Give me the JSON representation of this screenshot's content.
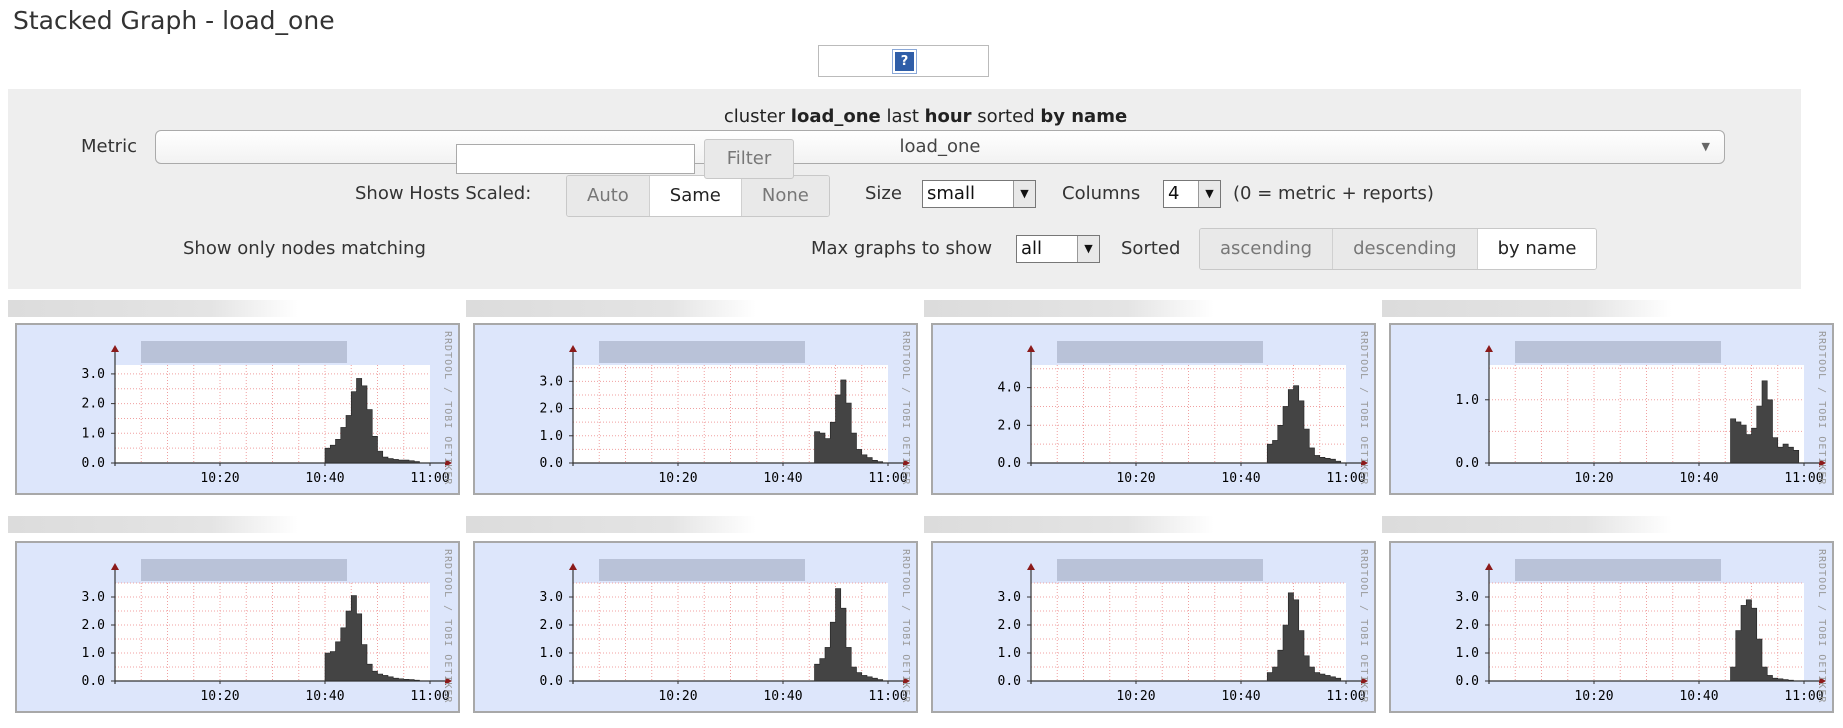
{
  "page": {
    "title": "Stacked Graph - load_one"
  },
  "help": {
    "icon": "help-icon",
    "glyph": "?"
  },
  "description": {
    "p1": "cluster ",
    "metric": "load_one",
    "p2": " last ",
    "range": "hour",
    "p3": " sorted ",
    "sort": "by name"
  },
  "controls": {
    "metric_label": "Metric",
    "metric_value": "load_one",
    "scaled_label": "Show Hosts Scaled:",
    "scaled_options": [
      "Auto",
      "Same",
      "None"
    ],
    "scaled_selected": "Same",
    "size_label": "Size",
    "size_value": "small",
    "columns_label": "Columns",
    "columns_value": "4",
    "columns_note": "(0 = metric + reports)",
    "filter_label": "Show only nodes matching",
    "filter_value": "",
    "filter_button": "Filter",
    "max_label": "Max graphs to show",
    "max_value": "all",
    "sorted_label": "Sorted",
    "sort_options": [
      "ascending",
      "descending",
      "by name"
    ],
    "sort_selected": "by name"
  },
  "graphs": {
    "x_ticks": [
      "10:20",
      "10:40",
      "11:00"
    ],
    "watermark": "RRDTOOL / TOBI OETIKER",
    "colors": {
      "background": "#dde6fb",
      "plot": "#ffffff",
      "grid": "#f0a0a0",
      "area": "#444444",
      "axis": "#333333",
      "arrow": "#8b1a1a"
    },
    "items": [
      {
        "yticks": [
          "0.0",
          "1.0",
          "2.0",
          "3.0"
        ],
        "ymax": 3.3,
        "series": [
          0,
          0,
          0,
          0,
          0,
          0,
          0,
          0,
          0,
          0,
          0,
          0,
          0,
          0,
          0,
          0,
          0,
          0,
          0,
          0,
          0,
          0,
          0,
          0,
          0,
          0,
          0,
          0,
          0,
          0,
          0,
          0,
          0,
          0,
          0,
          0,
          0,
          0,
          0,
          0,
          0.5,
          0.6,
          0.8,
          1.2,
          1.6,
          2.4,
          2.85,
          2.6,
          1.8,
          0.9,
          0.4,
          0.2,
          0.15,
          0.12,
          0.1,
          0.1,
          0.08,
          0.05,
          0,
          0
        ]
      },
      {
        "yticks": [
          "0.0",
          "1.0",
          "2.0",
          "3.0"
        ],
        "ymax": 3.6,
        "series": [
          0,
          0,
          0,
          0,
          0,
          0,
          0,
          0,
          0,
          0,
          0,
          0,
          0,
          0,
          0,
          0,
          0,
          0,
          0,
          0,
          0,
          0,
          0,
          0,
          0,
          0,
          0,
          0,
          0,
          0,
          0,
          0,
          0,
          0,
          0,
          0,
          0,
          0,
          0,
          0,
          0,
          0,
          0,
          0,
          0,
          0,
          1.15,
          1.1,
          0.9,
          1.5,
          2.5,
          3.05,
          2.2,
          1.1,
          0.5,
          0.3,
          0.2,
          0.1,
          0.05,
          0
        ]
      },
      {
        "yticks": [
          "0.0",
          "2.0",
          "4.0"
        ],
        "ymax": 5.2,
        "series": [
          0,
          0,
          0,
          0,
          0,
          0,
          0,
          0,
          0,
          0,
          0,
          0,
          0,
          0,
          0,
          0,
          0,
          0,
          0,
          0,
          0,
          0,
          0,
          0,
          0,
          0,
          0,
          0,
          0,
          0,
          0,
          0,
          0,
          0,
          0,
          0,
          0,
          0,
          0,
          0,
          0,
          0,
          0,
          0,
          0,
          1.0,
          1.2,
          2.0,
          3.0,
          3.9,
          4.1,
          3.3,
          1.8,
          0.8,
          0.4,
          0.3,
          0.25,
          0.2,
          0.1,
          0
        ]
      },
      {
        "yticks": [
          "0.0",
          "1.0"
        ],
        "ymax": 1.55,
        "series": [
          0,
          0,
          0,
          0,
          0,
          0,
          0,
          0,
          0,
          0,
          0,
          0,
          0,
          0,
          0,
          0,
          0,
          0,
          0,
          0,
          0,
          0,
          0,
          0,
          0,
          0,
          0,
          0,
          0,
          0,
          0,
          0,
          0,
          0,
          0,
          0,
          0,
          0,
          0,
          0,
          0,
          0,
          0,
          0,
          0,
          0,
          0.7,
          0.65,
          0.6,
          0.45,
          0.55,
          0.9,
          1.3,
          1.0,
          0.4,
          0.25,
          0.3,
          0.25,
          0.2,
          0
        ]
      },
      {
        "yticks": [
          "0.0",
          "1.0",
          "2.0",
          "3.0"
        ],
        "ymax": 3.5,
        "series": [
          0,
          0,
          0,
          0,
          0,
          0,
          0,
          0,
          0,
          0,
          0,
          0,
          0,
          0,
          0,
          0,
          0,
          0,
          0,
          0,
          0,
          0,
          0,
          0,
          0,
          0,
          0,
          0,
          0,
          0,
          0,
          0,
          0,
          0,
          0,
          0,
          0,
          0,
          0,
          0,
          1.0,
          1.05,
          1.4,
          1.9,
          2.5,
          3.05,
          2.4,
          1.3,
          0.6,
          0.35,
          0.25,
          0.2,
          0.15,
          0.1,
          0.08,
          0.06,
          0.05,
          0.03,
          0,
          0
        ]
      },
      {
        "yticks": [
          "0.0",
          "1.0",
          "2.0",
          "3.0"
        ],
        "ymax": 3.5,
        "series": [
          0,
          0,
          0,
          0,
          0,
          0,
          0,
          0,
          0,
          0,
          0,
          0,
          0,
          0,
          0,
          0,
          0,
          0,
          0,
          0,
          0,
          0,
          0,
          0,
          0,
          0,
          0,
          0,
          0,
          0,
          0,
          0,
          0,
          0,
          0,
          0,
          0,
          0,
          0,
          0,
          0,
          0,
          0,
          0,
          0,
          0,
          0.6,
          0.8,
          1.2,
          2.1,
          3.3,
          2.6,
          1.2,
          0.5,
          0.3,
          0.2,
          0.15,
          0.1,
          0.05,
          0
        ]
      },
      {
        "yticks": [
          "0.0",
          "1.0",
          "2.0",
          "3.0"
        ],
        "ymax": 3.5,
        "series": [
          0,
          0,
          0,
          0,
          0,
          0,
          0,
          0,
          0,
          0,
          0,
          0,
          0,
          0,
          0,
          0,
          0,
          0,
          0,
          0,
          0,
          0,
          0,
          0,
          0,
          0,
          0,
          0,
          0,
          0,
          0,
          0,
          0,
          0,
          0,
          0,
          0,
          0,
          0,
          0,
          0,
          0,
          0,
          0,
          0,
          0.3,
          0.5,
          1.1,
          2.0,
          3.15,
          2.9,
          1.8,
          0.9,
          0.5,
          0.3,
          0.25,
          0.2,
          0.15,
          0.1,
          0
        ]
      },
      {
        "yticks": [
          "0.0",
          "1.0",
          "2.0",
          "3.0"
        ],
        "ymax": 3.5,
        "series": [
          0,
          0,
          0,
          0,
          0,
          0,
          0,
          0,
          0,
          0,
          0,
          0,
          0,
          0,
          0,
          0,
          0,
          0,
          0,
          0,
          0,
          0,
          0,
          0,
          0,
          0,
          0,
          0,
          0,
          0,
          0,
          0,
          0,
          0,
          0,
          0,
          0,
          0,
          0,
          0,
          0,
          0,
          0,
          0,
          0,
          0,
          0.5,
          1.8,
          2.7,
          2.9,
          2.6,
          1.5,
          0.5,
          0.2,
          0.1,
          0.08,
          0.05,
          0.03,
          0,
          0
        ]
      }
    ]
  }
}
